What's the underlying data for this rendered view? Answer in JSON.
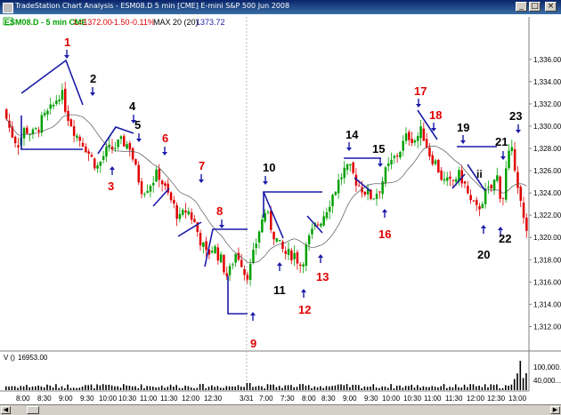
{
  "window": {
    "title": "TradeStation Chart Analysis - ESM08.D  5 min  [CME] E-mini S&P 500 Jun 2008"
  },
  "header": {
    "symbol": "ESM08.D - 5 min  CME",
    "last": "L=1372.00",
    "change": "-1.50",
    "change_pct": "-0.11%",
    "indicator_label": "MAX 20 (20)",
    "indicator_value": "1373.72"
  },
  "volume_panel": {
    "label": "V ()",
    "value": "16953.00",
    "axis_ticks": [
      "100,000...",
      "40,000..."
    ]
  },
  "colors": {
    "up_bar": "#00a000",
    "down_bar": "#e00000",
    "pattern_line": "#1a1aa8",
    "label_red": "#e00000",
    "label_black": "#000000",
    "marker_arrow": "#1a1aa8",
    "moving_average": "#555555"
  },
  "annotations": [
    {
      "text": "1",
      "color": "red"
    },
    {
      "text": "2",
      "color": "black"
    },
    {
      "text": "3",
      "color": "red"
    },
    {
      "text": "4",
      "color": "black"
    },
    {
      "text": "5",
      "color": "black"
    },
    {
      "text": "6",
      "color": "red"
    },
    {
      "text": "7",
      "color": "red"
    },
    {
      "text": "8",
      "color": "red"
    },
    {
      "text": "9",
      "color": "red"
    },
    {
      "text": "10",
      "color": "black"
    },
    {
      "text": "11",
      "color": "black"
    },
    {
      "text": "12",
      "color": "red"
    },
    {
      "text": "13",
      "color": "red"
    },
    {
      "text": "14",
      "color": "black"
    },
    {
      "text": "15",
      "color": "black"
    },
    {
      "text": "16",
      "color": "red"
    },
    {
      "text": "17",
      "color": "red"
    },
    {
      "text": "18",
      "color": "red"
    },
    {
      "text": "19",
      "color": "black"
    },
    {
      "text": "20",
      "color": "black"
    },
    {
      "text": "21",
      "color": "black"
    },
    {
      "text": "ii",
      "color": "black"
    },
    {
      "text": "22",
      "color": "black"
    },
    {
      "text": "23",
      "color": "black"
    }
  ],
  "chart_data": {
    "type": "candlestick",
    "title": "",
    "y_tick_labels": [
      "1,336.00",
      "1,334.00",
      "1,332.00",
      "1,330.00",
      "1,328.00",
      "1,326.00",
      "1,324.00",
      "1,322.00",
      "1,320.00",
      "1,318.00",
      "1,316.00",
      "1,314.00",
      "1,312.00"
    ],
    "ylim": [
      1311,
      1337.5
    ],
    "x_tick_labels": [
      "8:00",
      "8:30",
      "9:00",
      "9:30",
      "10:00",
      "10:30",
      "11:00",
      "11:30",
      "12:00",
      "12:30",
      "3/31",
      "7:00",
      "7:30",
      "8:00",
      "8:30",
      "9:00",
      "9:30",
      "10:00",
      "10:30",
      "11:00",
      "11:30",
      "12:00",
      "12:30",
      "13:00"
    ],
    "grid": false
  }
}
